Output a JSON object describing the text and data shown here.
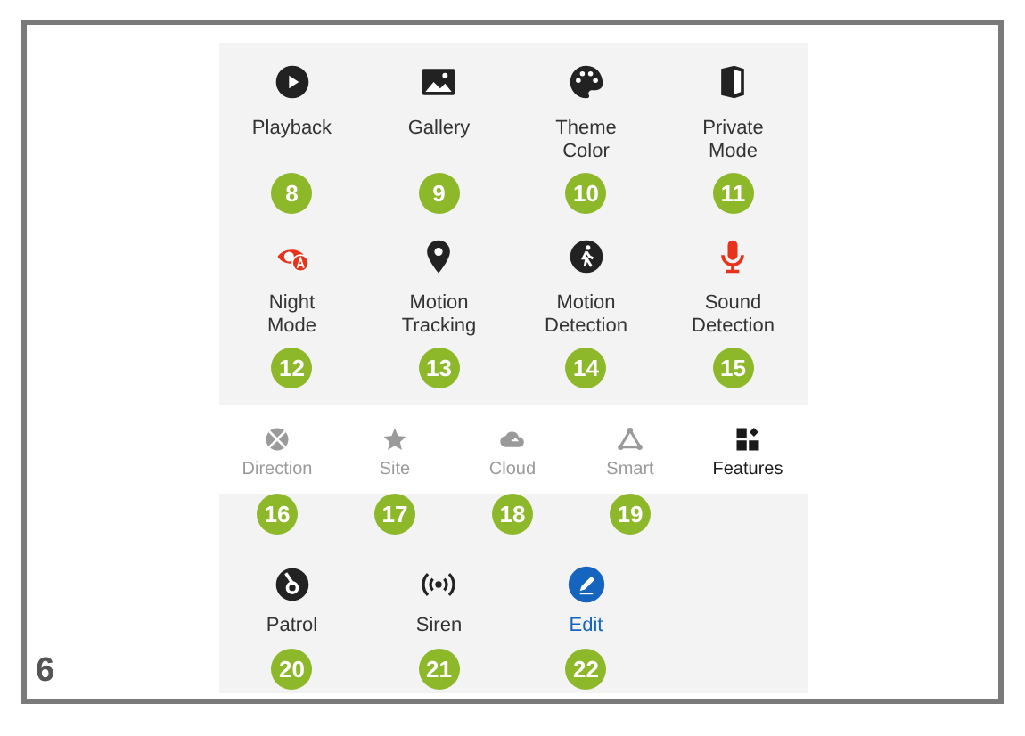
{
  "figure_number": "6",
  "features": [
    {
      "label": "Playback",
      "kind": "play",
      "color": "#222222",
      "badge": "8",
      "active": false
    },
    {
      "label": "Gallery",
      "kind": "image",
      "color": "#222222",
      "badge": "9",
      "active": false
    },
    {
      "label": "Theme Color",
      "kind": "palette",
      "color": "#222222",
      "badge": "10",
      "active": false
    },
    {
      "label": "Private Mode",
      "kind": "shield",
      "color": "#222222",
      "badge": "11",
      "active": false
    },
    {
      "label": "Night Mode",
      "kind": "night",
      "color": "#e8331c",
      "badge": "12",
      "active": false
    },
    {
      "label": "Motion Tracking",
      "kind": "pin",
      "color": "#222222",
      "badge": "13",
      "active": false
    },
    {
      "label": "Motion Detection",
      "kind": "walker",
      "color": "#222222",
      "badge": "14",
      "active": false
    },
    {
      "label": "Sound Detection",
      "kind": "mic",
      "color": "#e8331c",
      "badge": "15",
      "active": false
    }
  ],
  "tabs": [
    {
      "label": "Direction",
      "kind": "dpad",
      "selected": false,
      "badge": "16"
    },
    {
      "label": "Site",
      "kind": "star",
      "selected": false,
      "badge": "17"
    },
    {
      "label": "Cloud",
      "kind": "cloud",
      "selected": false,
      "badge": "18"
    },
    {
      "label": "Smart",
      "kind": "triangle",
      "selected": false,
      "badge": "19"
    },
    {
      "label": "Features",
      "kind": "grid",
      "selected": true
    }
  ],
  "more_features": [
    {
      "label": "Patrol",
      "kind": "disc",
      "color": "#222222",
      "badge": "20",
      "active": false
    },
    {
      "label": "Siren",
      "kind": "siren",
      "color": "#222222",
      "badge": "21",
      "active": false
    },
    {
      "label": "Edit",
      "kind": "edit",
      "color": "#1565c0",
      "badge": "22",
      "active": true
    }
  ]
}
